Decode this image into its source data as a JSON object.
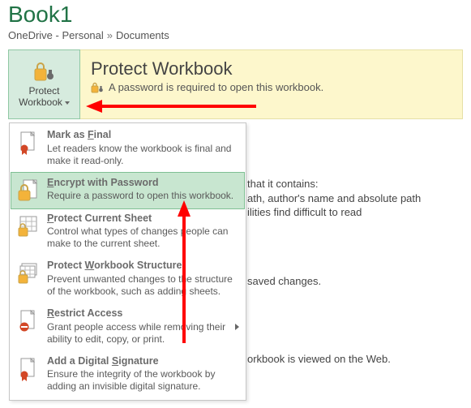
{
  "title": "Book1",
  "breadcrumb": {
    "a": "OneDrive - Personal",
    "b": "Documents"
  },
  "protect_button": {
    "line1": "Protect",
    "line2": "Workbook"
  },
  "yellow_panel": {
    "title": "Protect Workbook",
    "subtitle": "A password is required to open this workbook."
  },
  "menu": {
    "items": [
      {
        "title_pre": "Mark as ",
        "title_u": "F",
        "title_post": "inal",
        "desc": "Let readers know the workbook is final and make it read-only."
      },
      {
        "title_pre": "",
        "title_u": "E",
        "title_post": "ncrypt with Password",
        "desc": "Require a password to open this workbook."
      },
      {
        "title_pre": "",
        "title_u": "P",
        "title_post": "rotect Current Sheet",
        "desc": "Control what types of changes people can make to the current sheet."
      },
      {
        "title_pre": "Protect ",
        "title_u": "W",
        "title_post": "orkbook Structure",
        "desc": "Prevent unwanted changes to the structure of the workbook, such as adding sheets."
      },
      {
        "title_pre": "",
        "title_u": "R",
        "title_post": "estrict Access",
        "desc": "Grant people access while removing their ability to edit, copy, or print."
      },
      {
        "title_pre": "Add a Digital ",
        "title_u": "S",
        "title_post": "ignature",
        "desc": "Ensure the integrity of the workbook by adding an invisible digital signature."
      }
    ]
  },
  "background": {
    "block1_l1": "that it contains:",
    "block1_l2": "ath, author's name and absolute path",
    "block1_l3": "ilities find difficult to read",
    "block2_l1": "saved changes.",
    "block3_l1": "orkbook is viewed on the Web."
  },
  "colors": {
    "accent": "#217346",
    "highlight_bg": "#c8e6d0",
    "highlight_border": "#7fbf93",
    "yellow_bg": "#fdf7cc",
    "arrow": "#ff0000"
  }
}
